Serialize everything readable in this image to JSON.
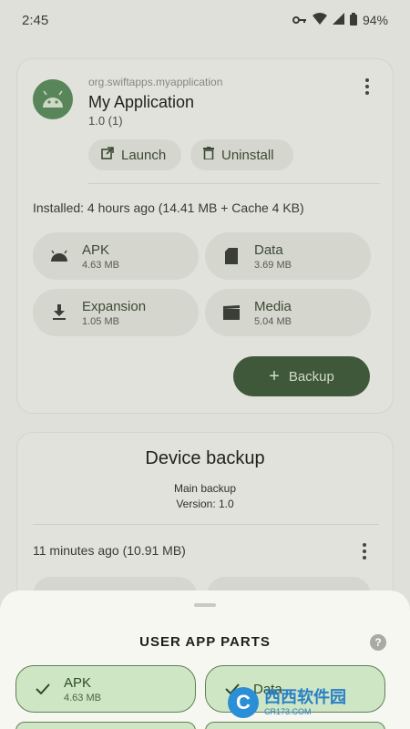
{
  "status_bar": {
    "time": "2:45",
    "battery": "94%",
    "icons": [
      "key-icon",
      "wifi-icon",
      "signal-icon",
      "battery-icon"
    ]
  },
  "app_card": {
    "package": "org.swiftapps.myapplication",
    "name": "My Application",
    "version": "1.0 (1)",
    "launch_label": "Launch",
    "uninstall_label": "Uninstall",
    "installed_info": "Installed: 4 hours ago (14.41 MB + Cache 4 KB)",
    "parts": [
      {
        "name": "APK",
        "size": "4.63 MB",
        "icon": "android-icon"
      },
      {
        "name": "Data",
        "size": "3.69 MB",
        "icon": "sd-card-icon"
      },
      {
        "name": "Expansion",
        "size": "1.05 MB",
        "icon": "download-icon"
      },
      {
        "name": "Media",
        "size": "5.04 MB",
        "icon": "movie-icon"
      }
    ],
    "backup_label": "Backup"
  },
  "device_backup": {
    "title": "Device backup",
    "main_backup": "Main backup",
    "version": "Version: 1.0",
    "time_info": "11 minutes ago (10.91 MB)"
  },
  "bottom_sheet": {
    "title": "USER APP PARTS",
    "help": "?",
    "parts": [
      {
        "name": "APK",
        "size": "4.63 MB",
        "checked": true
      },
      {
        "name": "Data",
        "size": "",
        "checked": true
      }
    ]
  },
  "watermark": {
    "text": "西西软件园",
    "url": "CR173.COM",
    "logo": "C"
  },
  "colors": {
    "accent": "#3e5a3a",
    "chip": "#dfe1d8",
    "selected": "#cfe6c4",
    "background": "#e9eae4"
  }
}
